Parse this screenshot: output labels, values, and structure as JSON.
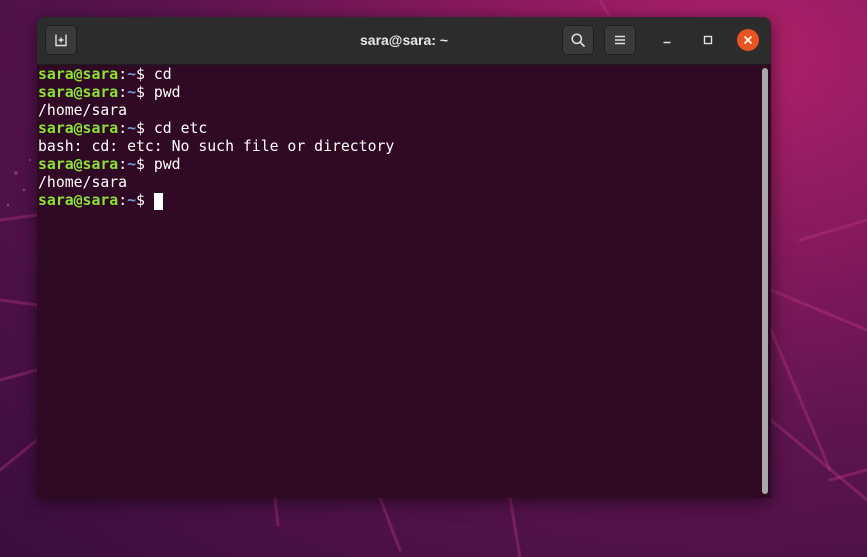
{
  "window": {
    "title": "sara@sara: ~"
  },
  "headerbar": {
    "new_tab_icon": "new-tab-icon",
    "search_icon": "search-icon",
    "menu_icon": "hamburger-menu-icon",
    "minimize_icon": "minimize-icon",
    "maximize_icon": "maximize-icon",
    "close_icon": "close-icon"
  },
  "colors": {
    "terminal_bg": "#300a24",
    "prompt_user": "#8ae234",
    "prompt_path": "#729fcf",
    "close_button": "#e95420"
  },
  "terminal": {
    "prompt": {
      "user_host": "sara@sara",
      "sep": ":",
      "path": "~",
      "symbol": "$ "
    },
    "lines": [
      {
        "type": "prompt",
        "command": "cd"
      },
      {
        "type": "prompt",
        "command": "pwd"
      },
      {
        "type": "output",
        "text": "/home/sara"
      },
      {
        "type": "prompt",
        "command": "cd etc"
      },
      {
        "type": "output",
        "text": "bash: cd: etc: No such file or directory"
      },
      {
        "type": "prompt",
        "command": "pwd"
      },
      {
        "type": "output",
        "text": "/home/sara"
      },
      {
        "type": "prompt",
        "command": ""
      }
    ]
  }
}
